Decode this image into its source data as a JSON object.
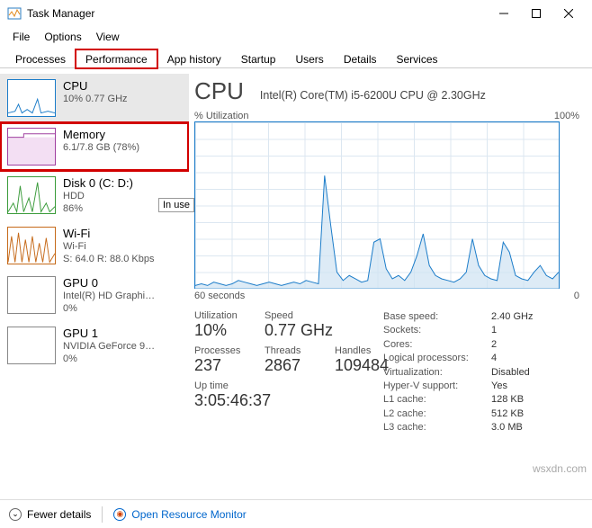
{
  "window": {
    "title": "Task Manager"
  },
  "menu": {
    "file": "File",
    "options": "Options",
    "view": "View"
  },
  "tabs": {
    "processes": "Processes",
    "performance": "Performance",
    "apphistory": "App history",
    "startup": "Startup",
    "users": "Users",
    "details": "Details",
    "services": "Services"
  },
  "sidebar": {
    "items": [
      {
        "title": "CPU",
        "sub1": "10% 0.77 GHz"
      },
      {
        "title": "Memory",
        "sub1": "6.1/7.8 GB (78%)"
      },
      {
        "title": "Disk 0 (C: D:)",
        "sub1": "HDD",
        "sub2": "86%"
      },
      {
        "title": "Wi-Fi",
        "sub1": "Wi-Fi",
        "sub2": "S: 64.0  R: 88.0 Kbps"
      },
      {
        "title": "GPU 0",
        "sub1": "Intel(R) HD Graphi…",
        "sub2": "0%"
      },
      {
        "title": "GPU 1",
        "sub1": "NVIDIA GeForce 9…",
        "sub2": "0%"
      }
    ],
    "tooltip": "In use"
  },
  "main": {
    "title": "CPU",
    "subtitle": "Intel(R) Core(TM) i5-6200U CPU @ 2.30GHz",
    "chart_label": "% Utilization",
    "chart_max": "100%",
    "x_left": "60 seconds",
    "x_right": "0",
    "stats": {
      "util_label": "Utilization",
      "util": "10%",
      "speed_label": "Speed",
      "speed": "0.77 GHz",
      "proc_label": "Processes",
      "proc": "237",
      "thr_label": "Threads",
      "thr": "2867",
      "hnd_label": "Handles",
      "hnd": "109484",
      "uptime_label": "Up time",
      "uptime": "3:05:46:37"
    },
    "specs": [
      {
        "k": "Base speed:",
        "v": "2.40 GHz"
      },
      {
        "k": "Sockets:",
        "v": "1"
      },
      {
        "k": "Cores:",
        "v": "2"
      },
      {
        "k": "Logical processors:",
        "v": "4"
      },
      {
        "k": "Virtualization:",
        "v": "Disabled"
      },
      {
        "k": "Hyper-V support:",
        "v": "Yes"
      },
      {
        "k": "L1 cache:",
        "v": "128 KB"
      },
      {
        "k": "L2 cache:",
        "v": "512 KB"
      },
      {
        "k": "L3 cache:",
        "v": "3.0 MB"
      }
    ]
  },
  "footer": {
    "fewer": "Fewer details",
    "orm": "Open Resource Monitor"
  },
  "watermark": "wsxdn.com",
  "chart_data": {
    "type": "line",
    "title": "% Utilization",
    "ylabel": "% Utilization",
    "ylim": [
      0,
      100
    ],
    "xlabel": "seconds",
    "xrange": [
      60,
      0
    ],
    "values": [
      2,
      3,
      2,
      4,
      3,
      2,
      3,
      5,
      4,
      3,
      2,
      3,
      4,
      3,
      2,
      3,
      4,
      3,
      5,
      4,
      3,
      68,
      38,
      10,
      5,
      8,
      6,
      4,
      5,
      28,
      30,
      12,
      6,
      8,
      5,
      10,
      20,
      33,
      14,
      8,
      6,
      5,
      4,
      6,
      10,
      30,
      14,
      8,
      6,
      5,
      28,
      22,
      8,
      6,
      5,
      10,
      14,
      8,
      6,
      10
    ]
  }
}
